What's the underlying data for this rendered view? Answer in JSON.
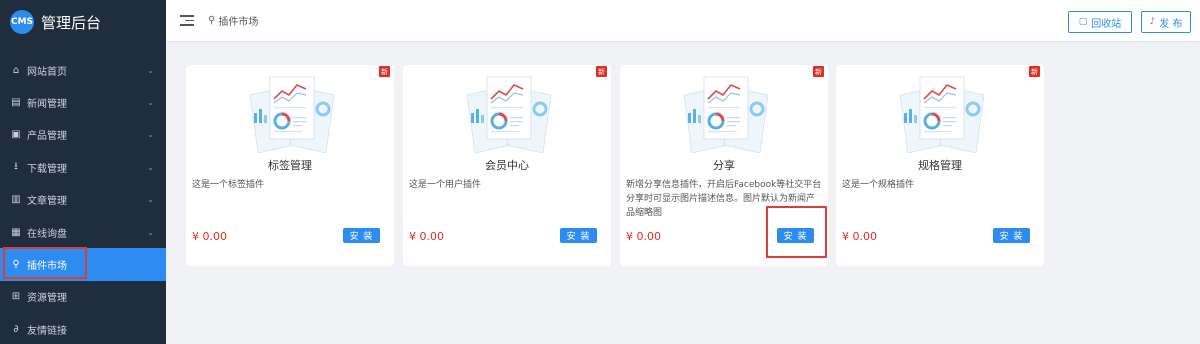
{
  "brand": {
    "logo_text": "CMS",
    "title": "管理后台"
  },
  "sidebar": {
    "items": [
      {
        "label": "网站首页",
        "icon": "home-icon",
        "glyph": "⌂",
        "expandable": true,
        "active": false
      },
      {
        "label": "新闻管理",
        "icon": "news-icon",
        "glyph": "▤",
        "expandable": true,
        "active": false
      },
      {
        "label": "产品管理",
        "icon": "product-icon",
        "glyph": "▣",
        "expandable": true,
        "active": false
      },
      {
        "label": "下载管理",
        "icon": "download-icon",
        "glyph": "⭳",
        "expandable": true,
        "active": false
      },
      {
        "label": "文章管理",
        "icon": "article-icon",
        "glyph": "▥",
        "expandable": true,
        "active": false
      },
      {
        "label": "在线询盘",
        "icon": "inquiry-icon",
        "glyph": "▦",
        "expandable": true,
        "active": false
      },
      {
        "label": "插件市场",
        "icon": "pin-icon",
        "glyph": "⚲",
        "expandable": false,
        "active": true
      },
      {
        "label": "资源管理",
        "icon": "grid-icon",
        "glyph": "⊞",
        "expandable": false,
        "active": false
      },
      {
        "label": "友情链接",
        "icon": "link-icon",
        "glyph": "∂",
        "expandable": false,
        "active": false
      }
    ]
  },
  "header": {
    "breadcrumb": "插件市场",
    "recycle_label": "回收站",
    "publish_label": "发 布"
  },
  "cards": [
    {
      "badge": "新",
      "title": "标签管理",
      "desc": "这是一个标签插件",
      "price": "¥ 0.00",
      "button": "安 装"
    },
    {
      "badge": "新",
      "title": "会员中心",
      "desc": "这是一个用户插件",
      "price": "¥ 0.00",
      "button": "安 装"
    },
    {
      "badge": "新",
      "title": "分享",
      "desc": "新增分享信息插件，开启后Facebook等社交平台分享时可显示图片描述信息。图片默认为新闻产品缩略图",
      "price": "¥ 0.00",
      "button": "安 装"
    },
    {
      "badge": "新",
      "title": "规格管理",
      "desc": "这是一个规格插件",
      "price": "¥ 0.00",
      "button": "安 装"
    }
  ],
  "colors": {
    "sidebar_bg": "#1f2d3d",
    "accent": "#2d8cf0",
    "price_red": "#e02e24",
    "highlight_red": "#e03b3b"
  }
}
